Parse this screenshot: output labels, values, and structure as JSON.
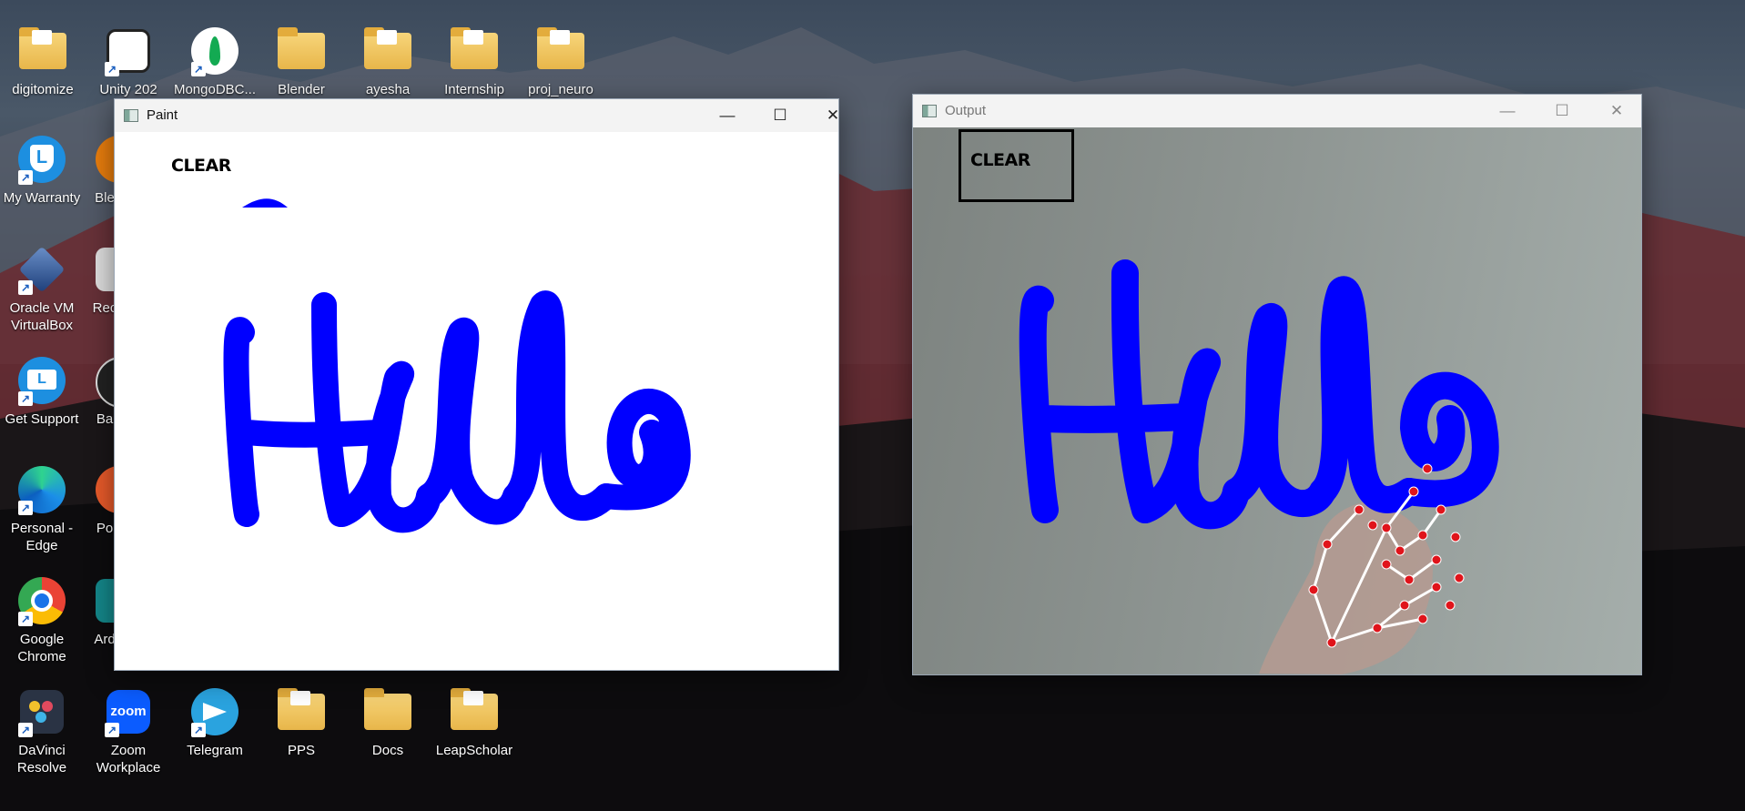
{
  "desktop": {
    "icons": [
      {
        "label": "digitomize",
        "icon": "folder-icon"
      },
      {
        "label": "Unity 202",
        "icon": "unity-icon"
      },
      {
        "label": "MongoDBC...",
        "icon": "mongodb-icon"
      },
      {
        "label": "Blender",
        "icon": "folder-icon"
      },
      {
        "label": "ayesha",
        "icon": "folder-icon"
      },
      {
        "label": "Internship",
        "icon": "folder-icon"
      },
      {
        "label": "proj_neuro",
        "icon": "folder-icon"
      },
      {
        "label": "My Warranty",
        "icon": "warranty-shield-icon"
      },
      {
        "label": "Ble",
        "icon": "blender-icon"
      },
      {
        "label": "Oracle VM VirtualBox",
        "icon": "virtualbox-icon"
      },
      {
        "label": "Rec",
        "icon": "recorder-icon"
      },
      {
        "label": "Get Support",
        "icon": "support-laptop-icon"
      },
      {
        "label": "Ba",
        "icon": "app-icon"
      },
      {
        "label": "Personal - Edge",
        "icon": "edge-icon"
      },
      {
        "label": "Po",
        "icon": "app-icon"
      },
      {
        "label": "Google Chrome",
        "icon": "chrome-icon"
      },
      {
        "label": "Ard",
        "icon": "arduino-icon"
      },
      {
        "label": "DaVinci Resolve",
        "icon": "davinci-icon"
      },
      {
        "label": "Zoom Workplace",
        "icon": "zoom-icon"
      },
      {
        "label": "Telegram",
        "icon": "telegram-icon"
      },
      {
        "label": "PPS",
        "icon": "folder-icon"
      },
      {
        "label": "Docs",
        "icon": "folder-icon"
      },
      {
        "label": "LeapScholar",
        "icon": "folder-icon"
      }
    ],
    "zoom_badge": "zoom"
  },
  "paint_window": {
    "title": "Paint",
    "clear_label": "CLEAR",
    "drawn_text": "Hello",
    "stroke_color": "#0000ff",
    "controls": {
      "minimize": "—",
      "maximize": "☐",
      "close": "✕"
    }
  },
  "output_window": {
    "title": "Output",
    "clear_label": "CLEAR",
    "drawn_text": "Hello",
    "stroke_color": "#0000ff",
    "landmark_color": "#e0141b",
    "controls": {
      "minimize": "—",
      "maximize": "☐",
      "close": "✕"
    }
  }
}
